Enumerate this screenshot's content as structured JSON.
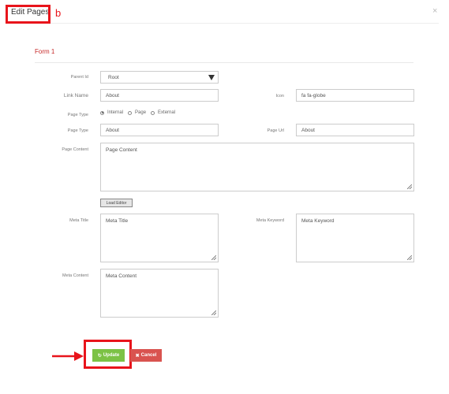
{
  "modal": {
    "title": "Edit Pages",
    "annotation_letter": "b",
    "close_glyph": "×"
  },
  "form": {
    "title": "Form 1",
    "parent_id": {
      "label": "Parent Id",
      "value": "Root"
    },
    "link_name": {
      "label": "Link Name",
      "value": "About"
    },
    "icon": {
      "label": "Icon",
      "value": "fa fa-globe"
    },
    "page_type_radio": {
      "label": "Page Type",
      "options": [
        "Internal",
        "Page",
        "External"
      ],
      "selected": "Internal"
    },
    "page_type": {
      "label": "Page Type",
      "value": "About"
    },
    "page_url": {
      "label": "Page Url",
      "value": "About"
    },
    "page_content": {
      "label": "Page Content",
      "value": "Page Content"
    },
    "load_editor_label": "Load Editor",
    "meta_title": {
      "label": "Meta Title",
      "value": "Meta Title"
    },
    "meta_keyword": {
      "label": "Meta Keyword",
      "value": "Meta Keyword"
    },
    "meta_content": {
      "label": "Meta Content",
      "value": "Meta Content"
    }
  },
  "actions": {
    "update_label": "Update",
    "cancel_label": "Cancel"
  },
  "colors": {
    "annotation": "#e8141b",
    "update_button": "#7cc245",
    "cancel_button": "#d9534f",
    "form_title": "#c62828"
  },
  "icons": {
    "update": "refresh-icon",
    "cancel": "close-icon",
    "annotation_arrow": "arrow-right-icon"
  }
}
